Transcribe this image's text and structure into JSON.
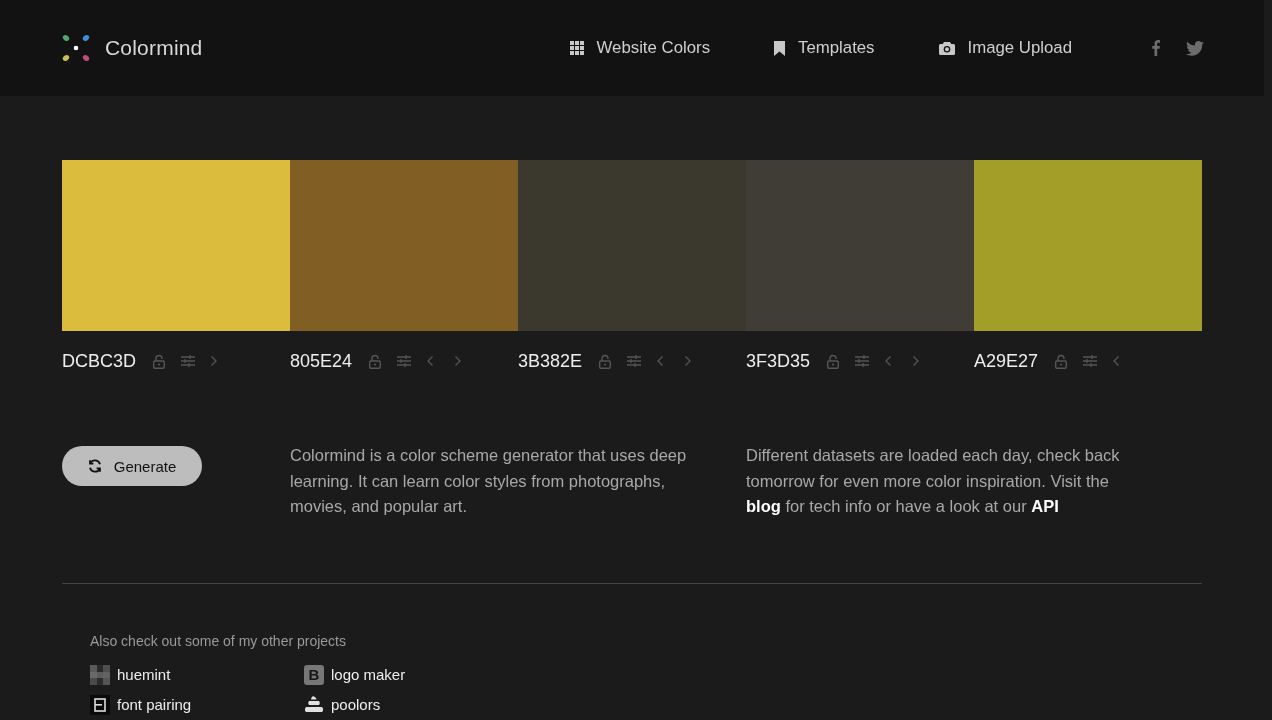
{
  "header": {
    "logo": "Colormind",
    "nav": [
      {
        "label": "Website Colors"
      },
      {
        "label": "Templates"
      },
      {
        "label": "Image Upload"
      }
    ]
  },
  "palette": [
    {
      "hex": "DCBC3D",
      "color": "#dcbc3d",
      "locked": false
    },
    {
      "hex": "805E24",
      "color": "#805e24",
      "locked": false
    },
    {
      "hex": "3B382E",
      "color": "#3b382e",
      "locked": false
    },
    {
      "hex": "3F3D35",
      "color": "#3f3d35",
      "locked": false
    },
    {
      "hex": "A29E27",
      "color": "#a29e27",
      "locked": false
    }
  ],
  "generate_button": {
    "label": "Generate"
  },
  "intro": "Colormind is a color scheme generator that uses deep learning. It can learn color styles from photographs, movies, and popular art.",
  "datasets_note": [
    {
      "text": "Different datasets are loaded each day, check back tomorrow for even more color inspiration. Visit the ",
      "link": false
    },
    {
      "text": "blog",
      "link": true
    },
    {
      "text": " for tech info or have a look at our ",
      "link": false
    },
    {
      "text": "API",
      "link": true
    }
  ],
  "projects": {
    "heading": "Also check out some of my other projects",
    "items": [
      {
        "label": "huemint"
      },
      {
        "label": "logo maker",
        "icon_letter": "B"
      },
      {
        "label": "font pairing"
      },
      {
        "label": "poolors"
      }
    ]
  }
}
